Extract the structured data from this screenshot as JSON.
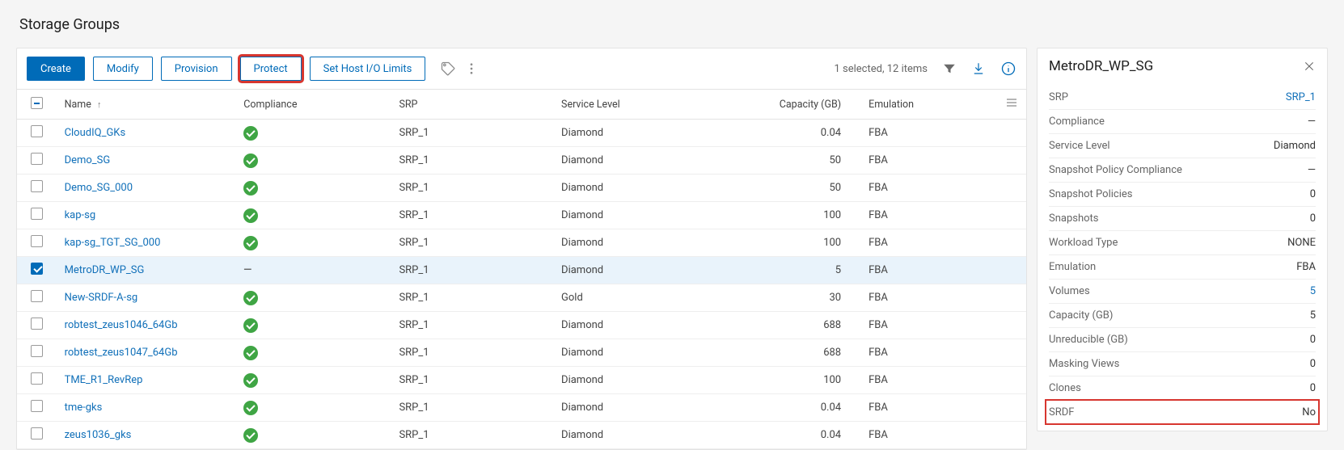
{
  "page": {
    "title": "Storage Groups"
  },
  "toolbar": {
    "create": "Create",
    "modify": "Modify",
    "provision": "Provision",
    "protect": "Protect",
    "host_io": "Set Host I/O Limits",
    "status": "1 selected, 12 items"
  },
  "columns": {
    "name": "Name",
    "compliance": "Compliance",
    "srp": "SRP",
    "service_level": "Service Level",
    "capacity": "Capacity (GB)",
    "emulation": "Emulation"
  },
  "rows": [
    {
      "name": "CloudIQ_GKs",
      "compliance": "ok",
      "srp": "SRP_1",
      "lvl": "Diamond",
      "cap": "0.04",
      "emu": "FBA",
      "selected": false
    },
    {
      "name": "Demo_SG",
      "compliance": "ok",
      "srp": "SRP_1",
      "lvl": "Diamond",
      "cap": "50",
      "emu": "FBA",
      "selected": false
    },
    {
      "name": "Demo_SG_000",
      "compliance": "ok",
      "srp": "SRP_1",
      "lvl": "Diamond",
      "cap": "50",
      "emu": "FBA",
      "selected": false
    },
    {
      "name": "kap-sg",
      "compliance": "ok",
      "srp": "SRP_1",
      "lvl": "Diamond",
      "cap": "100",
      "emu": "FBA",
      "selected": false
    },
    {
      "name": "kap-sg_TGT_SG_000",
      "compliance": "ok",
      "srp": "SRP_1",
      "lvl": "Diamond",
      "cap": "100",
      "emu": "FBA",
      "selected": false
    },
    {
      "name": "MetroDR_WP_SG",
      "compliance": "none",
      "srp": "SRP_1",
      "lvl": "Diamond",
      "cap": "5",
      "emu": "FBA",
      "selected": true
    },
    {
      "name": "New-SRDF-A-sg",
      "compliance": "ok",
      "srp": "SRP_1",
      "lvl": "Gold",
      "cap": "30",
      "emu": "FBA",
      "selected": false
    },
    {
      "name": "robtest_zeus1046_64Gb",
      "compliance": "ok",
      "srp": "SRP_1",
      "lvl": "Diamond",
      "cap": "688",
      "emu": "FBA",
      "selected": false
    },
    {
      "name": "robtest_zeus1047_64Gb",
      "compliance": "ok",
      "srp": "SRP_1",
      "lvl": "Diamond",
      "cap": "688",
      "emu": "FBA",
      "selected": false
    },
    {
      "name": "TME_R1_RevRep",
      "compliance": "ok",
      "srp": "SRP_1",
      "lvl": "Diamond",
      "cap": "100",
      "emu": "FBA",
      "selected": false
    },
    {
      "name": "tme-gks",
      "compliance": "ok",
      "srp": "SRP_1",
      "lvl": "Diamond",
      "cap": "0.04",
      "emu": "FBA",
      "selected": false
    },
    {
      "name": "zeus1036_gks",
      "compliance": "ok",
      "srp": "SRP_1",
      "lvl": "Diamond",
      "cap": "0.04",
      "emu": "FBA",
      "selected": false
    }
  ],
  "side": {
    "title": "MetroDR_WP_SG",
    "props": [
      {
        "key": "SRP",
        "val": "SRP_1",
        "link": true
      },
      {
        "key": "Compliance",
        "val": "—"
      },
      {
        "key": "Service Level",
        "val": "Diamond"
      },
      {
        "key": "Snapshot Policy Compliance",
        "val": "—"
      },
      {
        "key": "Snapshot Policies",
        "val": "0"
      },
      {
        "key": "Snapshots",
        "val": "0"
      },
      {
        "key": "Workload Type",
        "val": "NONE"
      },
      {
        "key": "Emulation",
        "val": "FBA"
      },
      {
        "key": "Volumes",
        "val": "5",
        "link": true
      },
      {
        "key": "Capacity (GB)",
        "val": "5"
      },
      {
        "key": "Unreducible (GB)",
        "val": "0"
      },
      {
        "key": "Masking Views",
        "val": "0"
      },
      {
        "key": "Clones",
        "val": "0"
      },
      {
        "key": "SRDF",
        "val": "No",
        "highlight": true
      }
    ]
  }
}
